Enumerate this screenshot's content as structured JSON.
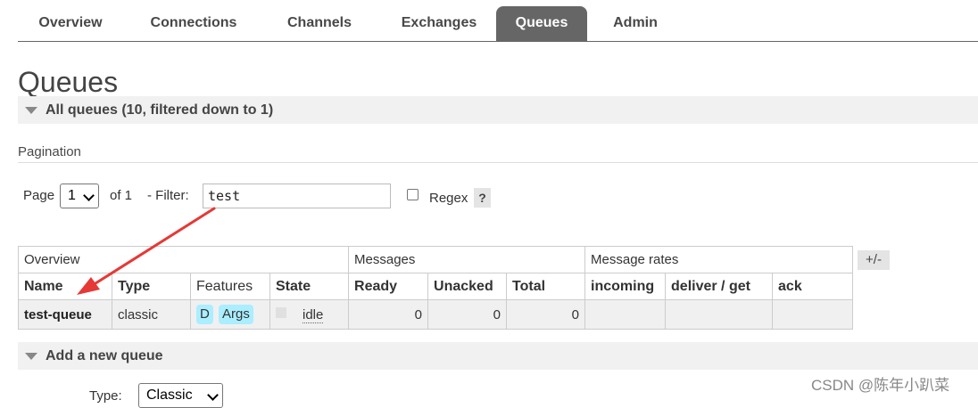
{
  "nav": {
    "tabs": [
      {
        "label": "Overview"
      },
      {
        "label": "Connections"
      },
      {
        "label": "Channels"
      },
      {
        "label": "Exchanges"
      },
      {
        "label": "Queues"
      },
      {
        "label": "Admin"
      }
    ],
    "active_tab": "Queues"
  },
  "page_title": "Queues",
  "all_queues_section": {
    "label": "All queues (10, filtered down to 1)"
  },
  "pagination": {
    "section_label": "Pagination",
    "page_label": "Page",
    "page_value": "1",
    "of_label": "of 1",
    "filter_label": "- Filter:",
    "filter_value": "test",
    "regex_label": "Regex",
    "help_label": "?"
  },
  "queues_table": {
    "groups": [
      "Overview",
      "Messages",
      "Message rates"
    ],
    "columns": {
      "name": "Name",
      "type": "Type",
      "features": "Features",
      "state": "State",
      "ready": "Ready",
      "unacked": "Unacked",
      "total": "Total",
      "incoming": "incoming",
      "deliver_get": "deliver / get",
      "ack": "ack"
    },
    "rows": [
      {
        "name": "test-queue",
        "type": "classic",
        "features": [
          "D",
          "Args"
        ],
        "state": "idle",
        "ready": "0",
        "unacked": "0",
        "total": "0",
        "incoming": "",
        "deliver_get": "",
        "ack": ""
      }
    ],
    "toggle_columns_label": "+/-"
  },
  "add_queue_section": {
    "label": "Add a new queue",
    "type_label": "Type:",
    "type_value": "Classic"
  },
  "watermark": "CSDN @陈年小趴菜",
  "colors": {
    "active_tab_bg": "#666666",
    "section_bar_bg": "#f1f1f1",
    "badge_bg": "#aaeeff",
    "annotation_arrow": "#e53935"
  }
}
